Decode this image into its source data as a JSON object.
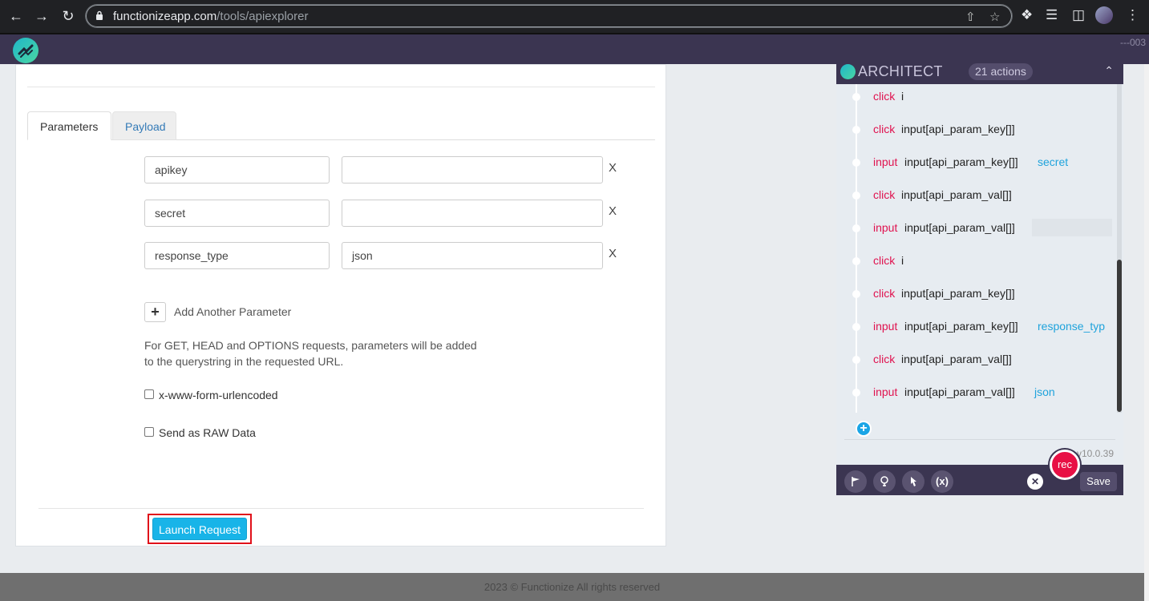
{
  "browser": {
    "url_domain": "functionizeapp.com",
    "url_path": "/tools/apiexplorer"
  },
  "app": {
    "header_right": "---003"
  },
  "tabs": [
    {
      "label": "Parameters",
      "active": true
    },
    {
      "label": "Payload",
      "active": false
    }
  ],
  "parameters": [
    {
      "key": "apikey",
      "value": "",
      "remove": "X"
    },
    {
      "key": "secret",
      "value": "",
      "remove": "X"
    },
    {
      "key": "response_type",
      "value": "json",
      "remove": "X"
    }
  ],
  "add_parameter_label": "Add Another Parameter",
  "note": "For GET, HEAD and OPTIONS requests, parameters will be added to the querystring in the requested URL.",
  "checkboxes": [
    {
      "label": "x-www-form-urlencoded",
      "checked": false
    },
    {
      "label": "Send as RAW Data",
      "checked": false
    }
  ],
  "launch_button": "Launch Request",
  "footer": "2023 © Functionize All rights reserved",
  "architect": {
    "title": "ARCHITECT",
    "count": "21 actions",
    "actions": [
      {
        "verb": "click",
        "target": "i",
        "value": ""
      },
      {
        "verb": "click",
        "target": "input[api_param_key[]]",
        "value": ""
      },
      {
        "verb": "input",
        "target": "input[api_param_key[]]",
        "value": "secret"
      },
      {
        "verb": "click",
        "target": "input[api_param_val[]]",
        "value": ""
      },
      {
        "verb": "input",
        "target": "input[api_param_val[]]",
        "value": ""
      },
      {
        "verb": "click",
        "target": "i",
        "value": ""
      },
      {
        "verb": "click",
        "target": "input[api_param_key[]]",
        "value": ""
      },
      {
        "verb": "input",
        "target": "input[api_param_key[]]",
        "value": "response_typ"
      },
      {
        "verb": "click",
        "target": "input[api_param_val[]]",
        "value": ""
      },
      {
        "verb": "input",
        "target": "input[api_param_val[]]",
        "value": "json"
      }
    ],
    "version": "v10.0.39",
    "rec_label": "rec",
    "save_label": "Save",
    "tools": [
      "flag-icon",
      "lightbulb-icon",
      "pointer-icon",
      "variable-icon"
    ],
    "variable_tool_label": "(x)"
  },
  "colors": {
    "brand_purple": "#3b3551",
    "launch_blue": "#18b4e8",
    "verb_red": "#e0124f",
    "value_blue": "#1fa3dc",
    "highlight_red": "#e0101a"
  }
}
